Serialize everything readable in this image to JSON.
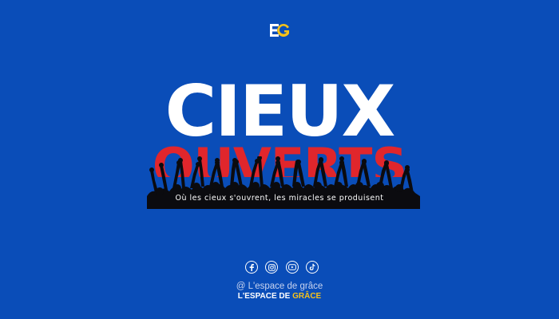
{
  "logo": {
    "text": "EG"
  },
  "hero": {
    "line1": "CIEUX",
    "line2": "OUVERTS",
    "tagline": "Où les cieux s'ouvrent, les miracles se produisent"
  },
  "socials": [
    {
      "icon": "facebook-icon"
    },
    {
      "icon": "instagram-icon"
    },
    {
      "icon": "youtube-icon"
    },
    {
      "icon": "tiktok-icon"
    }
  ],
  "footer": {
    "handle": "@ L'espace de grâce",
    "brand_main": "L'ESPACE DE ",
    "brand_accent": "GRÂCE"
  },
  "colors": {
    "background": "#0a4db8",
    "title_white": "#ffffff",
    "title_red": "#e0262c",
    "accent_yellow": "#f6c21a"
  }
}
